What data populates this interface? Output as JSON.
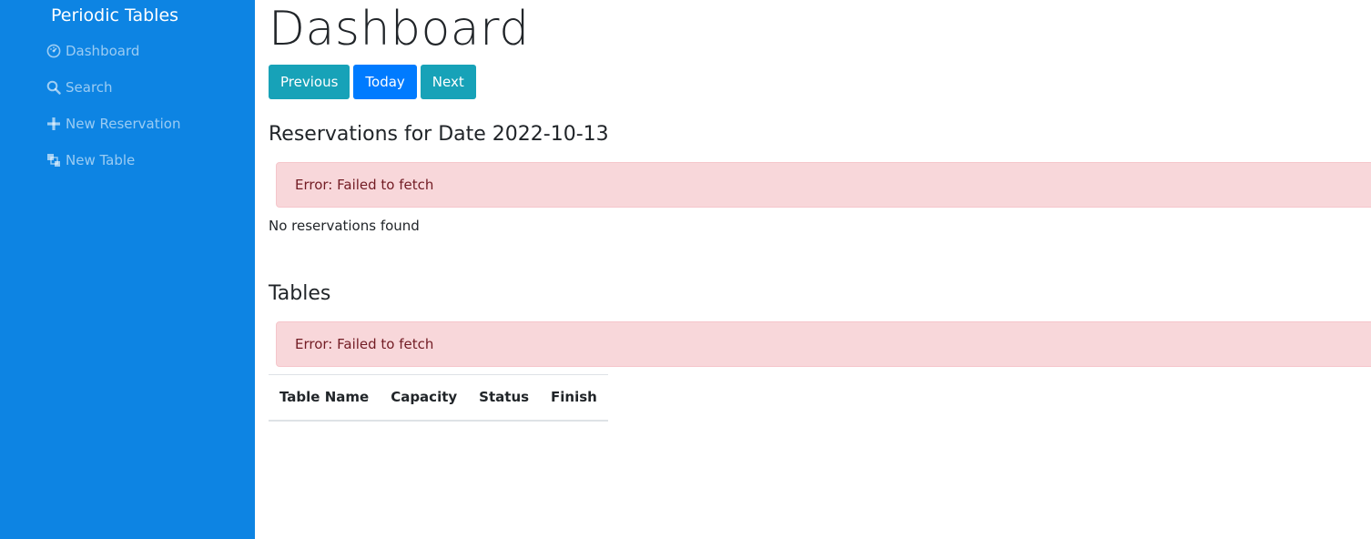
{
  "sidebar": {
    "brand": "Periodic Tables",
    "items": [
      {
        "label": "Dashboard",
        "icon": "dashboard-icon"
      },
      {
        "label": "Search",
        "icon": "search-icon"
      },
      {
        "label": "New Reservation",
        "icon": "plus-icon"
      },
      {
        "label": "New Table",
        "icon": "layers-icon"
      }
    ]
  },
  "main": {
    "title": "Dashboard",
    "buttons": {
      "previous": "Previous",
      "today": "Today",
      "next": "Next"
    },
    "reservations": {
      "heading": "Reservations for Date 2022-10-13",
      "error": "Error: Failed to fetch",
      "empty": "No reservations found"
    },
    "tables": {
      "heading": "Tables",
      "error": "Error: Failed to fetch",
      "columns": [
        "Table Name",
        "Capacity",
        "Status",
        "Finish"
      ]
    }
  },
  "colors": {
    "sidebar_bg": "#0d84e3",
    "btn_info": "#17a2b8",
    "btn_primary": "#007bff",
    "alert_bg": "#f8d7da",
    "alert_text": "#721c24"
  }
}
